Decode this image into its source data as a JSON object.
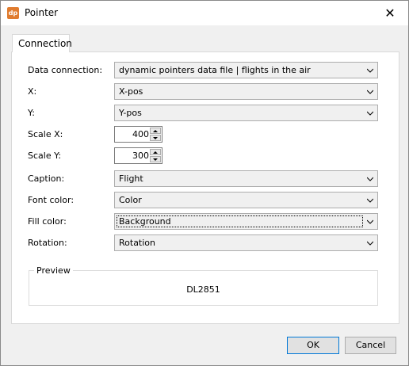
{
  "window": {
    "title": "Pointer",
    "app_icon_text": "dp"
  },
  "tabs": [
    {
      "label": "Connection"
    }
  ],
  "form": {
    "data_connection": {
      "label": "Data connection:",
      "value": "dynamic pointers data file | flights in the air"
    },
    "x": {
      "label": "X:",
      "value": "X-pos"
    },
    "y": {
      "label": "Y:",
      "value": "Y-pos"
    },
    "scale_x": {
      "label": "Scale X:",
      "value": "400"
    },
    "scale_y": {
      "label": "Scale Y:",
      "value": "300"
    },
    "caption": {
      "label": "Caption:",
      "value": "Flight"
    },
    "font_color": {
      "label": "Font color:",
      "value": "Color"
    },
    "fill_color": {
      "label": "Fill color:",
      "value": "Background"
    },
    "rotation": {
      "label": "Rotation:",
      "value": "Rotation"
    }
  },
  "preview": {
    "legend": "Preview",
    "text": "DL2851"
  },
  "buttons": {
    "ok": "OK",
    "cancel": "Cancel"
  },
  "colors": {
    "app_icon": "#e07b2e",
    "ok_border": "#0078d7"
  }
}
